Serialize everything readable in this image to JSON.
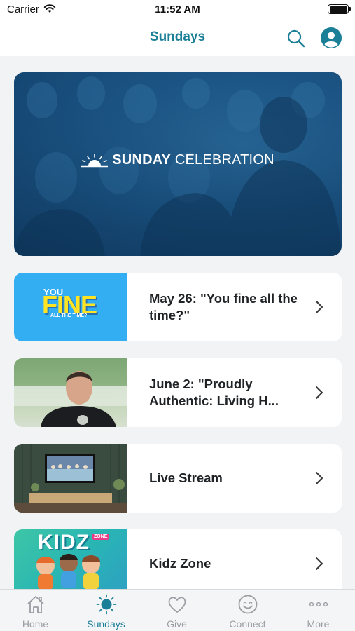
{
  "status_bar": {
    "carrier": "Carrier",
    "time": "11:52 AM"
  },
  "nav": {
    "title": "Sundays",
    "search_icon": "search-icon",
    "profile_icon": "profile-icon"
  },
  "hero": {
    "title_bold": "SUNDAY",
    "title_regular": "CELEBRATION"
  },
  "items": [
    {
      "title": "May 26: \"You fine all the time?\"",
      "thumb_text": {
        "line1": "YOU",
        "line2": "FINE",
        "line3": "ALL THE TIME?"
      }
    },
    {
      "title": "June 2: \"Proudly Authentic: Living H..."
    },
    {
      "title": "Live Stream"
    },
    {
      "title": "Kidz Zone",
      "thumb_text": {
        "main": "KIDZ",
        "badge": "ZONE"
      }
    }
  ],
  "tabs": [
    {
      "label": "Home",
      "icon": "home-icon"
    },
    {
      "label": "Sundays",
      "icon": "sun-icon",
      "active": true
    },
    {
      "label": "Give",
      "icon": "heart-icon"
    },
    {
      "label": "Connect",
      "icon": "smiley-icon"
    },
    {
      "label": "More",
      "icon": "more-dots-icon"
    }
  ],
  "colors": {
    "accent": "#1b7f97",
    "inactive": "#9a9ea3",
    "background": "#f2f3f5"
  }
}
